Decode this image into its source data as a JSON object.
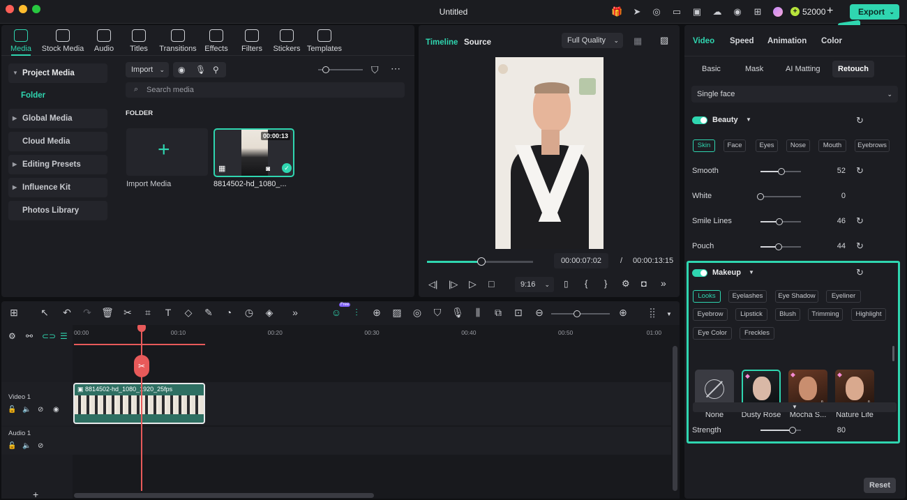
{
  "window": {
    "title": "Untitled",
    "credits": "52000",
    "export_label": "Export"
  },
  "media_tabs": [
    {
      "label": "Media",
      "icon": "media-icon"
    },
    {
      "label": "Stock Media",
      "icon": "stock-media-icon"
    },
    {
      "label": "Audio",
      "icon": "audio-icon"
    },
    {
      "label": "Titles",
      "icon": "titles-icon"
    },
    {
      "label": "Transitions",
      "icon": "transitions-icon"
    },
    {
      "label": "Effects",
      "icon": "effects-icon"
    },
    {
      "label": "Filters",
      "icon": "filters-icon"
    },
    {
      "label": "Stickers",
      "icon": "stickers-icon"
    },
    {
      "label": "Templates",
      "icon": "templates-icon"
    }
  ],
  "sidebar": {
    "project_media": "Project Media",
    "folder": "Folder",
    "global_media": "Global Media",
    "cloud_media": "Cloud Media",
    "editing_presets": "Editing Presets",
    "influence_kit": "Influence Kit",
    "photos_library": "Photos Library"
  },
  "library": {
    "import_label": "Import",
    "search_placeholder": "Search media",
    "folder_heading": "FOLDER",
    "import_media_label": "Import Media",
    "clip_name": "8814502-hd_1080_...",
    "clip_duration": "00:00:13"
  },
  "preview": {
    "tab_timeline": "Timeline",
    "tab_source": "Source",
    "quality": "Full Quality",
    "current_time": "00:00:07:02",
    "separator": "/",
    "total_time": "00:00:13:15",
    "aspect": "9:16",
    "playhead_progress": 0.51
  },
  "properties": {
    "tabs": [
      "Video",
      "Speed",
      "Animation",
      "Color"
    ],
    "subtabs": [
      "Basic",
      "Mask",
      "AI Matting",
      "Retouch"
    ],
    "face_select": "Single face",
    "beauty": {
      "title": "Beauty",
      "chips": [
        "Skin",
        "Face",
        "Eyes",
        "Nose",
        "Mouth",
        "Eyebrows"
      ],
      "sliders": [
        {
          "label": "Smooth",
          "value": "52",
          "level": 0.52
        },
        {
          "label": "White",
          "value": "0",
          "level": 0
        },
        {
          "label": "Smile Lines",
          "value": "46",
          "level": 0.46
        },
        {
          "label": "Pouch",
          "value": "44",
          "level": 0.44
        }
      ]
    },
    "makeup": {
      "title": "Makeup",
      "chips_row1": [
        "Looks",
        "Eyelashes",
        "Eye Shadow",
        "Eyeliner"
      ],
      "chips_row2": [
        "Eyebrow",
        "Lipstick",
        "Blush",
        "Trimming",
        "Highlight"
      ],
      "chips_row3": [
        "Eye Color",
        "Freckles"
      ],
      "looks": [
        "None",
        "Dusty Rose",
        "Mocha S...",
        "Nature Life"
      ],
      "strength_label": "Strength",
      "strength_value": "80",
      "strength_level": 0.8
    },
    "reset_label": "Reset"
  },
  "timeline": {
    "ruler": [
      "00:00",
      "00:10",
      "00:20",
      "00:30",
      "00:40",
      "00:50",
      "01:00"
    ],
    "video_track": "Video 1",
    "audio_track": "Audio 1",
    "clip_label": "8814502-hd_1080_1920_25fps",
    "badge": "Free"
  },
  "colors": {
    "accent": "#2fd6b0",
    "playhead": "#e85a5a"
  }
}
